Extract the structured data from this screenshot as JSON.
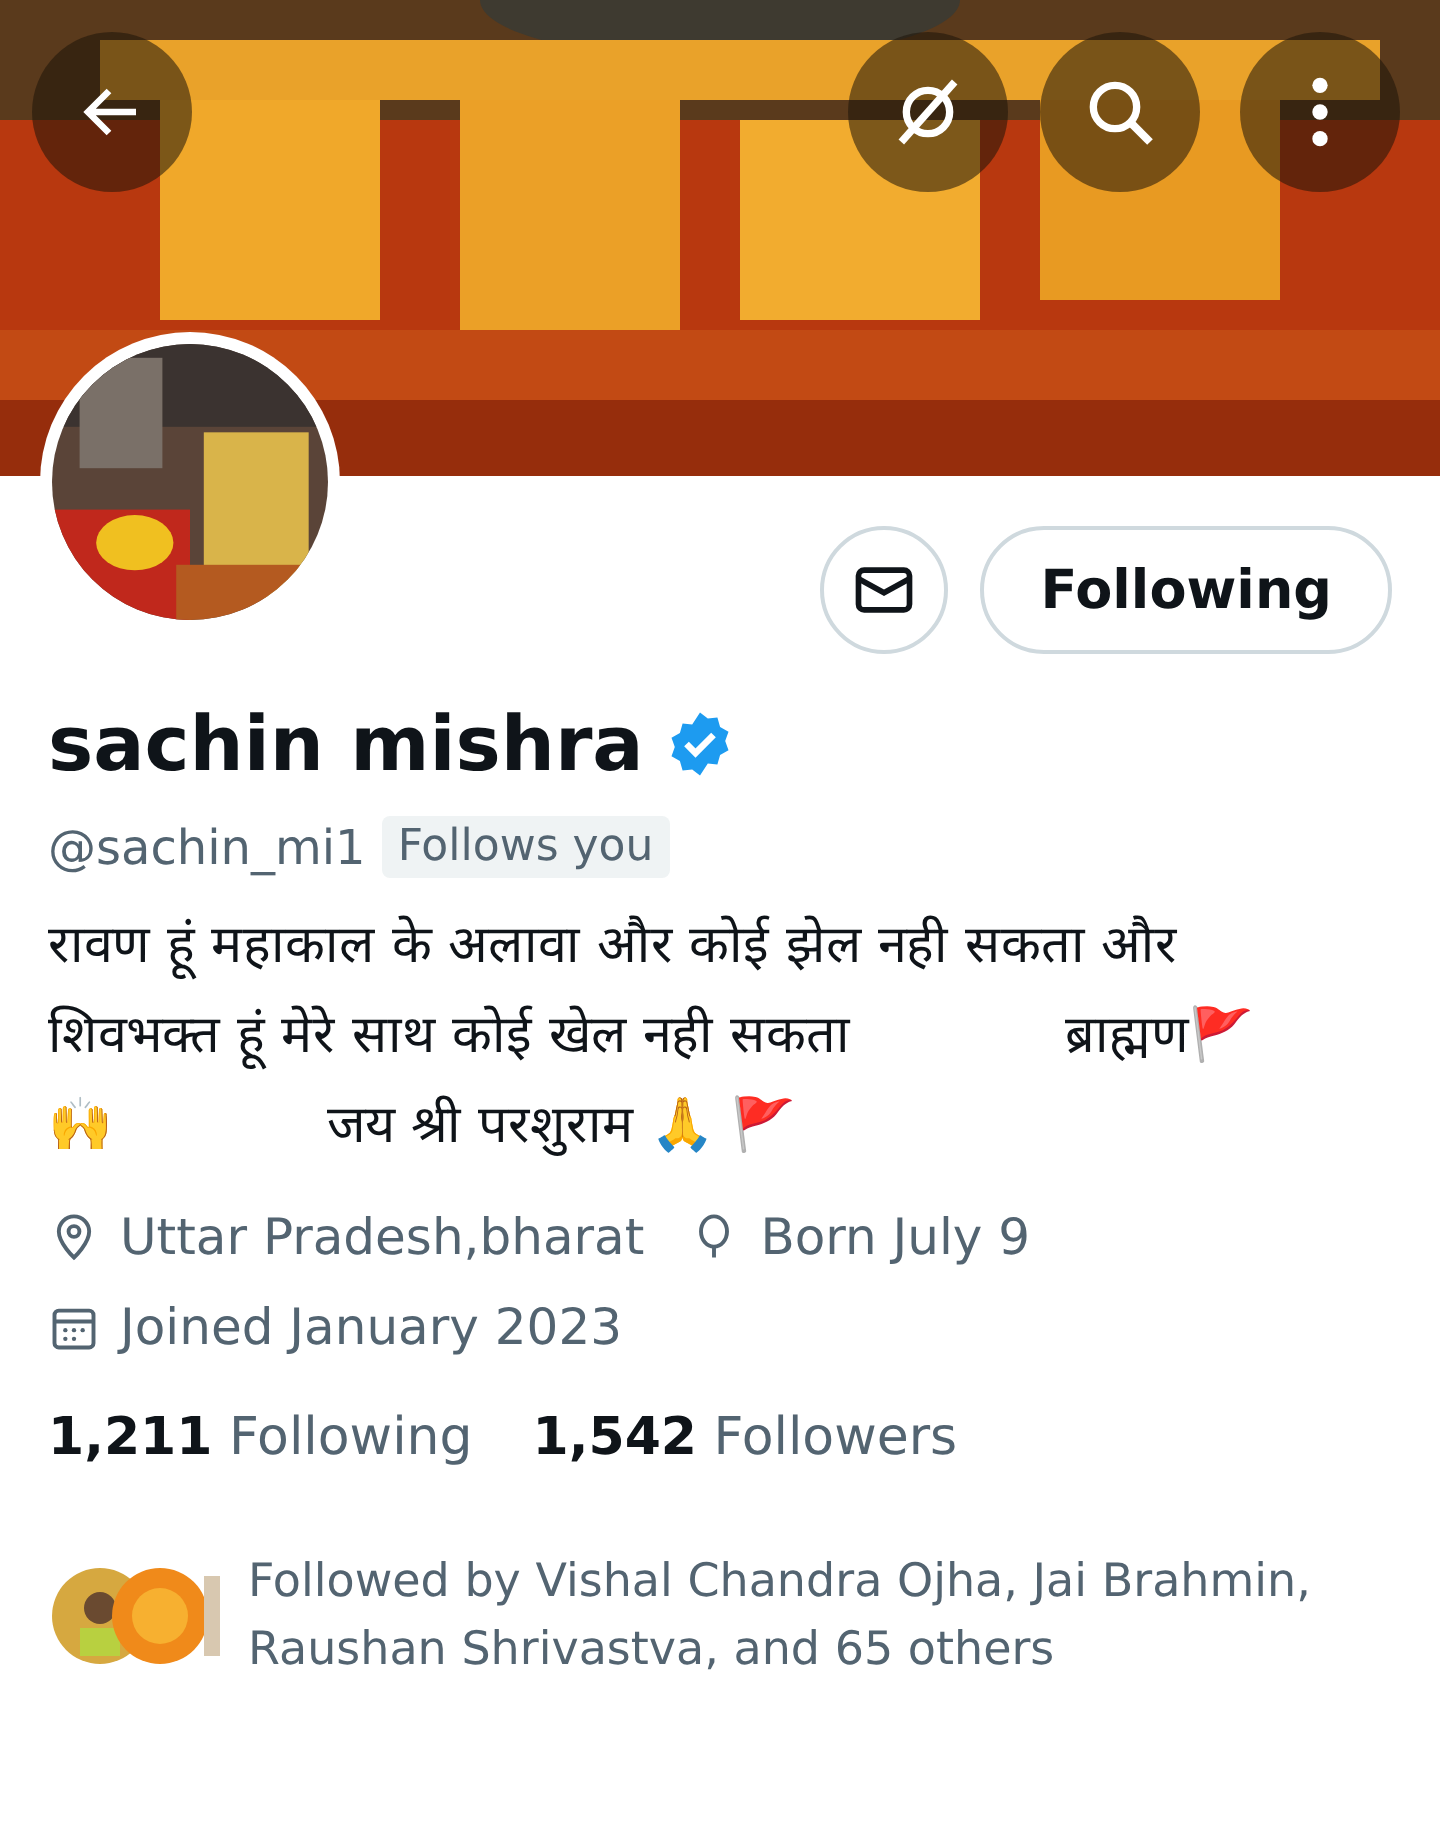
{
  "header": {
    "kind": "picture",
    "buttons": [
      {
        "kind": "back"
      },
      {
        "kind": "grok"
      },
      {
        "kind": "search"
      },
      {
        "kind": "more"
      }
    ]
  },
  "actions": {
    "message": {
      "kind": "mail"
    },
    "follow_button": "Following"
  },
  "profile": {
    "name": "sachin mishra",
    "verified": true,
    "handle": "@sachin_mi1",
    "follows_you": "Follows you",
    "bio": "रावण हूं महाकाल के अलावा और कोई झेल नही सकता और शिवभक्त हूं मेरे साथ कोई खेल नही सकता             ब्राह्मण🚩\n🙌             जय श्री परशुराम 🙏 🚩",
    "meta": [
      {
        "kind": "location",
        "text": "Uttar Pradesh,bharat"
      },
      {
        "kind": "birthday",
        "text": "Born July 9"
      },
      {
        "kind": "joined",
        "text": "Joined January 2023"
      }
    ]
  },
  "stats": [
    {
      "count": "1,211",
      "label": "Following"
    },
    {
      "count": "1,542",
      "label": "Followers"
    }
  ],
  "followed_by": "Followed by Vishal Chandra Ojha, Jai Brahmin, Raushan Shrivastva, and 65 others"
}
